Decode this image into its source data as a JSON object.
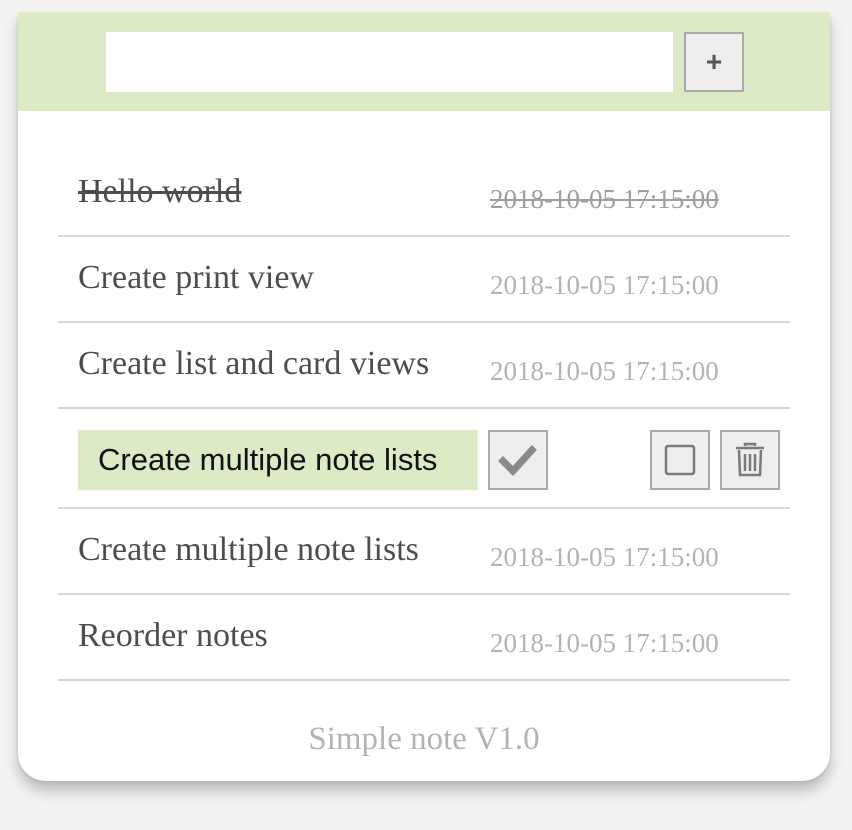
{
  "new_note": {
    "value": "",
    "placeholder": "",
    "add_label": "+"
  },
  "notes": [
    {
      "title": "Hello world",
      "time": "2018-10-05 17:15:00",
      "done": true
    },
    {
      "title": "Create print view",
      "time": "2018-10-05 17:15:00",
      "done": false
    },
    {
      "title": "Create list and card views",
      "time": "2018-10-05 17:15:00",
      "done": false
    }
  ],
  "editing_note": {
    "value": "Create multiple note lists",
    "confirm_icon": "check-icon",
    "toggle_icon": "checkbox-icon",
    "delete_icon": "trash-icon"
  },
  "notes_after": [
    {
      "title": "Create multiple note lists",
      "time": "2018-10-05 17:15:00",
      "done": false
    },
    {
      "title": "Reorder notes",
      "time": "2018-10-05 17:15:00",
      "done": false
    }
  ],
  "footer": {
    "text": "Simple note V1.0"
  },
  "colors": {
    "header_bg": "#dcebc6",
    "edit_bg": "#dcebc6",
    "muted_text": "#b3b3b3",
    "title_text": "#4d4d4d"
  }
}
